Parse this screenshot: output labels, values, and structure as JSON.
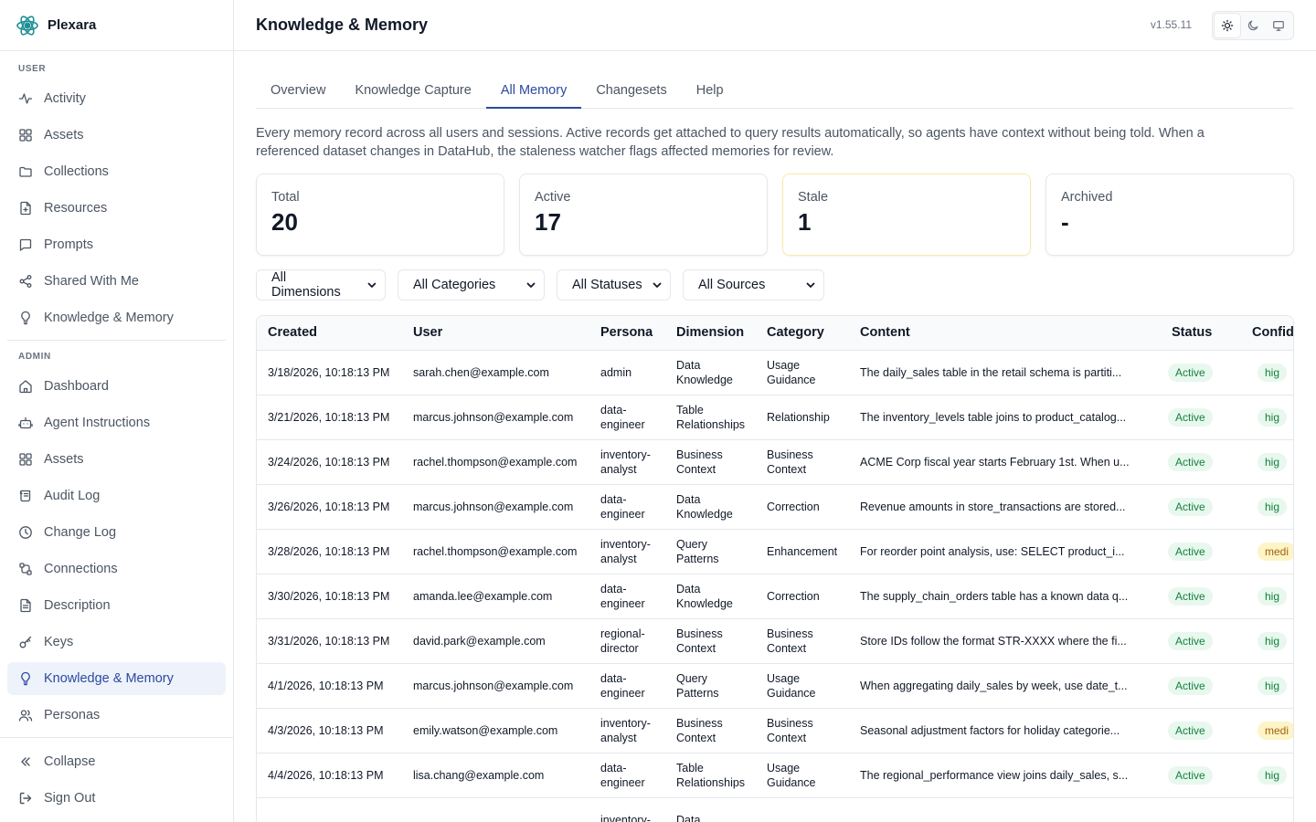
{
  "app": {
    "name": "Plexara",
    "version": "v1.55.11"
  },
  "sidebar": {
    "user_label": "USER",
    "user_items": [
      {
        "label": "Activity",
        "icon": "activity-icon"
      },
      {
        "label": "Assets",
        "icon": "grid-icon"
      },
      {
        "label": "Collections",
        "icon": "folder-icon"
      },
      {
        "label": "Resources",
        "icon": "file-plus-icon"
      },
      {
        "label": "Prompts",
        "icon": "message-icon"
      },
      {
        "label": "Shared With Me",
        "icon": "share-icon"
      },
      {
        "label": "Knowledge & Memory",
        "icon": "lightbulb-icon"
      }
    ],
    "admin_label": "ADMIN",
    "admin_items": [
      {
        "label": "Dashboard",
        "icon": "home-icon"
      },
      {
        "label": "Agent Instructions",
        "icon": "bot-icon"
      },
      {
        "label": "Assets",
        "icon": "grid-icon"
      },
      {
        "label": "Audit Log",
        "icon": "scroll-icon"
      },
      {
        "label": "Change Log",
        "icon": "clock-icon"
      },
      {
        "label": "Connections",
        "icon": "connections-icon"
      },
      {
        "label": "Description",
        "icon": "document-icon"
      },
      {
        "label": "Keys",
        "icon": "key-icon"
      },
      {
        "label": "Knowledge & Memory",
        "icon": "lightbulb-icon",
        "active": true
      },
      {
        "label": "Personas",
        "icon": "users-icon"
      }
    ],
    "collapse": "Collapse",
    "sign_out": "Sign Out"
  },
  "header": {
    "title": "Knowledge & Memory"
  },
  "tabs": [
    "Overview",
    "Knowledge Capture",
    "All Memory",
    "Changesets",
    "Help"
  ],
  "active_tab": "All Memory",
  "intro": "Every memory record across all users and sessions. Active records get attached to query results automatically, so agents have context without being told. When a referenced dataset changes in DataHub, the staleness watcher flags affected memories for review.",
  "stats": [
    {
      "label": "Total",
      "value": "20"
    },
    {
      "label": "Active",
      "value": "17"
    },
    {
      "label": "Stale",
      "value": "1"
    },
    {
      "label": "Archived",
      "value": "-"
    }
  ],
  "filters": [
    "All Dimensions",
    "All Categories",
    "All Statuses",
    "All Sources"
  ],
  "table": {
    "columns": [
      "Created",
      "User",
      "Persona",
      "Dimension",
      "Category",
      "Content",
      "Status",
      "Confid"
    ],
    "rows": [
      {
        "created": "3/18/2026, 10:18:13 PM",
        "user": "sarah.chen@example.com",
        "persona": "admin",
        "dimension": "Data Knowledge",
        "category": "Usage Guidance",
        "content": "The daily_sales table in the retail schema is partiti...",
        "status": "Active",
        "confidence": "hig"
      },
      {
        "created": "3/21/2026, 10:18:13 PM",
        "user": "marcus.johnson@example.com",
        "persona": "data-engineer",
        "dimension": "Table Relationships",
        "category": "Relationship",
        "content": "The inventory_levels table joins to product_catalog...",
        "status": "Active",
        "confidence": "hig"
      },
      {
        "created": "3/24/2026, 10:18:13 PM",
        "user": "rachel.thompson@example.com",
        "persona": "inventory-analyst",
        "dimension": "Business Context",
        "category": "Business Context",
        "content": "ACME Corp fiscal year starts February 1st. When u...",
        "status": "Active",
        "confidence": "hig"
      },
      {
        "created": "3/26/2026, 10:18:13 PM",
        "user": "marcus.johnson@example.com",
        "persona": "data-engineer",
        "dimension": "Data Knowledge",
        "category": "Correction",
        "content": "Revenue amounts in store_transactions are stored...",
        "status": "Active",
        "confidence": "hig"
      },
      {
        "created": "3/28/2026, 10:18:13 PM",
        "user": "rachel.thompson@example.com",
        "persona": "inventory-analyst",
        "dimension": "Query Patterns",
        "category": "Enhancement",
        "content": "For reorder point analysis, use: SELECT product_i...",
        "status": "Active",
        "confidence": "medi"
      },
      {
        "created": "3/30/2026, 10:18:13 PM",
        "user": "amanda.lee@example.com",
        "persona": "data-engineer",
        "dimension": "Data Knowledge",
        "category": "Correction",
        "content": "The supply_chain_orders table has a known data q...",
        "status": "Active",
        "confidence": "hig"
      },
      {
        "created": "3/31/2026, 10:18:13 PM",
        "user": "david.park@example.com",
        "persona": "regional-director",
        "dimension": "Business Context",
        "category": "Business Context",
        "content": "Store IDs follow the format STR-XXXX where the fi...",
        "status": "Active",
        "confidence": "hig"
      },
      {
        "created": "4/1/2026, 10:18:13 PM",
        "user": "marcus.johnson@example.com",
        "persona": "data-engineer",
        "dimension": "Query Patterns",
        "category": "Usage Guidance",
        "content": "When aggregating daily_sales by week, use date_t...",
        "status": "Active",
        "confidence": "hig"
      },
      {
        "created": "4/3/2026, 10:18:13 PM",
        "user": "emily.watson@example.com",
        "persona": "inventory-analyst",
        "dimension": "Business Context",
        "category": "Business Context",
        "content": "Seasonal adjustment factors for holiday categorie...",
        "status": "Active",
        "confidence": "medi"
      },
      {
        "created": "4/4/2026, 10:18:13 PM",
        "user": "lisa.chang@example.com",
        "persona": "data-engineer",
        "dimension": "Table Relationships",
        "category": "Usage Guidance",
        "content": "The regional_performance view joins daily_sales, s...",
        "status": "Active",
        "confidence": "hig"
      },
      {
        "created": "",
        "user": "",
        "persona": "inventory-",
        "dimension": "Data",
        "category": "",
        "content": "",
        "status": "",
        "confidence": ""
      }
    ]
  },
  "colors": {
    "accent": "#2b4a9e",
    "active_bg": "#eef2fb",
    "success": "#15803d",
    "warning": "#a16207"
  }
}
